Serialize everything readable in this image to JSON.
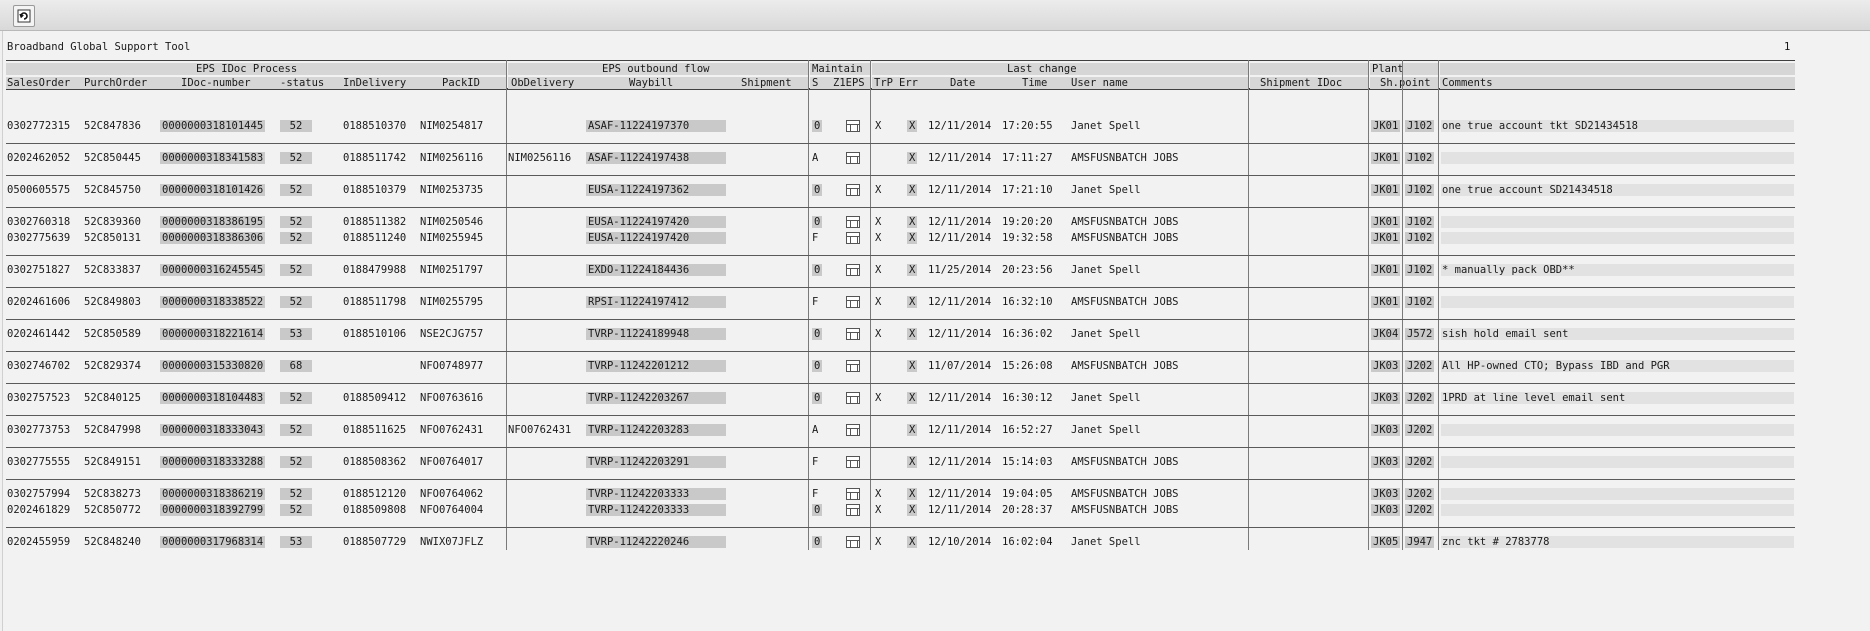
{
  "app": {
    "title": "Broadband Global Support Tool",
    "page_number": "1"
  },
  "toolbar": {
    "refresh_icon": "refresh-icon"
  },
  "groups": {
    "eps_idoc": "EPS IDoc Process",
    "eps_outbound": "EPS outbound flow",
    "maintain": "Maintain",
    "last_change": "Last change",
    "plant": "Plant"
  },
  "columns": {
    "sales_order": "SalesOrder",
    "purch_order": "PurchOrder",
    "idoc_number": "IDoc-number",
    "status": "-status",
    "in_delivery": "InDelivery",
    "pack_id": "PackID",
    "ob_delivery": "ObDelivery",
    "waybill": "Waybill",
    "shipment": "Shipment",
    "s": "S",
    "z1eps": "Z1EPS",
    "trp": "TrP",
    "err": "Err",
    "date": "Date",
    "time": "Time",
    "user_name": "User name",
    "shipment_idoc": "Shipment IDoc",
    "sh_point": "Sh.point",
    "comments": "Comments"
  },
  "rows": [
    {
      "sales_order": "0302772315",
      "purch_order": "52C847836",
      "idoc": "0000000318101445",
      "status": "52",
      "in_delivery": "0188510370",
      "pack_id": "NIM0254817",
      "ob_delivery": "",
      "waybill": "ASAF-11224197370",
      "s": "0",
      "trp": "X",
      "err": "X",
      "date": "12/11/2014",
      "time": "17:20:55",
      "user": "Janet Spell",
      "plant": "JK01",
      "shpoint": "J102",
      "comment": "one true account tkt SD21434518"
    },
    {
      "sales_order": "0202462052",
      "purch_order": "52C850445",
      "idoc": "0000000318341583",
      "status": "52",
      "in_delivery": "0188511742",
      "pack_id": "NIM0256116",
      "ob_delivery": "NIM0256116",
      "waybill": "ASAF-11224197438",
      "s": "A",
      "trp": "",
      "err": "X",
      "date": "12/11/2014",
      "time": "17:11:27",
      "user": "AMSFUSNBATCH JOBS",
      "plant": "JK01",
      "shpoint": "J102",
      "comment": ""
    },
    {
      "sales_order": "0500605575",
      "purch_order": "52C845750",
      "idoc": "0000000318101426",
      "status": "52",
      "in_delivery": "0188510379",
      "pack_id": "NIM0253735",
      "ob_delivery": "",
      "waybill": "EUSA-11224197362",
      "s": "0",
      "trp": "X",
      "err": "X",
      "date": "12/11/2014",
      "time": "17:21:10",
      "user": "Janet Spell",
      "plant": "JK01",
      "shpoint": "J102",
      "comment": "one true account SD21434518"
    },
    {
      "sales_order": "0302760318",
      "purch_order": "52C839360",
      "idoc": "0000000318386195",
      "status": "52",
      "in_delivery": "0188511382",
      "pack_id": "NIM0250546",
      "ob_delivery": "",
      "waybill": "EUSA-11224197420",
      "s": "0",
      "trp": "X",
      "err": "X",
      "date": "12/11/2014",
      "time": "19:20:20",
      "user": "AMSFUSNBATCH JOBS",
      "plant": "JK01",
      "shpoint": "J102",
      "comment": ""
    },
    {
      "sales_order": "0302775639",
      "purch_order": "52C850131",
      "idoc": "0000000318386306",
      "status": "52",
      "in_delivery": "0188511240",
      "pack_id": "NIM0255945",
      "ob_delivery": "",
      "waybill": "EUSA-11224197420",
      "s": "F",
      "trp": "X",
      "err": "X",
      "date": "12/11/2014",
      "time": "19:32:58",
      "user": "AMSFUSNBATCH JOBS",
      "plant": "JK01",
      "shpoint": "J102",
      "comment": ""
    },
    {
      "sales_order": "0302751827",
      "purch_order": "52C833837",
      "idoc": "0000000316245545",
      "status": "52",
      "in_delivery": "0188479988",
      "pack_id": "NIM0251797",
      "ob_delivery": "",
      "waybill": "EXDO-11224184436",
      "s": "0",
      "trp": "X",
      "err": "X",
      "date": "11/25/2014",
      "time": "20:23:56",
      "user": "Janet Spell",
      "plant": "JK01",
      "shpoint": "J102",
      "comment": "* manually pack OBD**"
    },
    {
      "sales_order": "0202461606",
      "purch_order": "52C849803",
      "idoc": "0000000318338522",
      "status": "52",
      "in_delivery": "0188511798",
      "pack_id": "NIM0255795",
      "ob_delivery": "",
      "waybill": "RPSI-11224197412",
      "s": "F",
      "trp": "X",
      "err": "X",
      "date": "12/11/2014",
      "time": "16:32:10",
      "user": "AMSFUSNBATCH JOBS",
      "plant": "JK01",
      "shpoint": "J102",
      "comment": ""
    },
    {
      "sales_order": "0202461442",
      "purch_order": "52C850589",
      "idoc": "0000000318221614",
      "status": "53",
      "in_delivery": "0188510106",
      "pack_id": "NSE2CJG757",
      "ob_delivery": "",
      "waybill": "TVRP-11224189948",
      "s": "0",
      "trp": "X",
      "err": "X",
      "date": "12/11/2014",
      "time": "16:36:02",
      "user": "Janet Spell",
      "plant": "JK04",
      "shpoint": "J572",
      "comment": "sish hold email sent"
    },
    {
      "sales_order": "0302746702",
      "purch_order": "52C829374",
      "idoc": "0000000315330820",
      "status": "68",
      "in_delivery": "",
      "pack_id": "NFO0748977",
      "ob_delivery": "",
      "waybill": "TVRP-11242201212",
      "s": "0",
      "trp": "",
      "err": "X",
      "date": "11/07/2014",
      "time": "15:26:08",
      "user": "AMSFUSNBATCH JOBS",
      "plant": "JK03",
      "shpoint": "J202",
      "comment": "All HP-owned CTO; Bypass IBD and PGR"
    },
    {
      "sales_order": "0302757523",
      "purch_order": "52C840125",
      "idoc": "0000000318104483",
      "status": "52",
      "in_delivery": "0188509412",
      "pack_id": "NFO0763616",
      "ob_delivery": "",
      "waybill": "TVRP-11242203267",
      "s": "0",
      "trp": "X",
      "err": "X",
      "date": "12/11/2014",
      "time": "16:30:12",
      "user": "Janet Spell",
      "plant": "JK03",
      "shpoint": "J202",
      "comment": "1PRD at line level email sent"
    },
    {
      "sales_order": "0302773753",
      "purch_order": "52C847998",
      "idoc": "0000000318333043",
      "status": "52",
      "in_delivery": "0188511625",
      "pack_id": "NFO0762431",
      "ob_delivery": "NFO0762431",
      "waybill": "TVRP-11242203283",
      "s": "A",
      "trp": "",
      "err": "X",
      "date": "12/11/2014",
      "time": "16:52:27",
      "user": "Janet Spell",
      "plant": "JK03",
      "shpoint": "J202",
      "comment": ""
    },
    {
      "sales_order": "0302775555",
      "purch_order": "52C849151",
      "idoc": "0000000318333288",
      "status": "52",
      "in_delivery": "0188508362",
      "pack_id": "NFO0764017",
      "ob_delivery": "",
      "waybill": "TVRP-11242203291",
      "s": "F",
      "trp": "",
      "err": "X",
      "date": "12/11/2014",
      "time": "15:14:03",
      "user": "AMSFUSNBATCH JOBS",
      "plant": "JK03",
      "shpoint": "J202",
      "comment": ""
    },
    {
      "sales_order": "0302757994",
      "purch_order": "52C838273",
      "idoc": "0000000318386219",
      "status": "52",
      "in_delivery": "0188512120",
      "pack_id": "NFO0764062",
      "ob_delivery": "",
      "waybill": "TVRP-11242203333",
      "s": "F",
      "trp": "X",
      "err": "X",
      "date": "12/11/2014",
      "time": "19:04:05",
      "user": "AMSFUSNBATCH JOBS",
      "plant": "JK03",
      "shpoint": "J202",
      "comment": ""
    },
    {
      "sales_order": "0202461829",
      "purch_order": "52C850772",
      "idoc": "0000000318392799",
      "status": "52",
      "in_delivery": "0188509808",
      "pack_id": "NFO0764004",
      "ob_delivery": "",
      "waybill": "TVRP-11242203333",
      "s": "0",
      "trp": "X",
      "err": "X",
      "date": "12/11/2014",
      "time": "20:28:37",
      "user": "AMSFUSNBATCH JOBS",
      "plant": "JK03",
      "shpoint": "J202",
      "comment": ""
    },
    {
      "sales_order": "0202455959",
      "purch_order": "52C848240",
      "idoc": "0000000317968314",
      "status": "53",
      "in_delivery": "0188507729",
      "pack_id": "NWIX07JFLZ",
      "ob_delivery": "",
      "waybill": "TVRP-11242220246",
      "s": "0",
      "trp": "X",
      "err": "X",
      "date": "12/10/2014",
      "time": "16:02:04",
      "user": "Janet Spell",
      "plant": "JK05",
      "shpoint": "J947",
      "comment": "znc tkt # 2783778"
    }
  ]
}
